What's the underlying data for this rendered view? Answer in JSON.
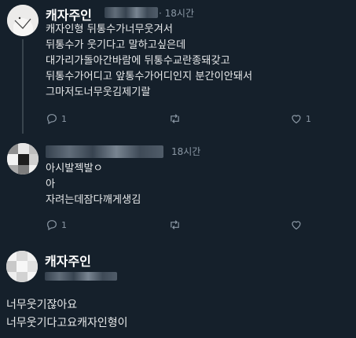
{
  "tweet1": {
    "name": "캐자주인",
    "time": "· 18시간",
    "lines": [
      "캐자인형 뒤통수가너무웃겨서",
      "뒤통수가 웃기다고 말하고싶은데",
      "대가리가돌아간바람에 뒤통수교란종돼갖고",
      "뒤통수가어디고 앞통수가어디인지 분간이안돼서",
      "그마저도너무웃김제기랄"
    ],
    "reply_count": "1",
    "like_count": "1"
  },
  "tweet2": {
    "time": "18시간",
    "lines": [
      "아시발젝발ㅇ",
      "아",
      "자려는데잠다깨게생김"
    ],
    "reply_count": "1"
  },
  "tweet3": {
    "name": "캐자주인",
    "lines": [
      "너무웃기잖아요",
      "너무웃기다고요캐자인형이"
    ]
  },
  "icons": {
    "reply": "reply-icon",
    "retweet": "retweet-icon",
    "like": "heart-icon"
  },
  "colors": {
    "background": "#15202b",
    "text": "#e7e9ea",
    "muted": "#8b98a5"
  }
}
